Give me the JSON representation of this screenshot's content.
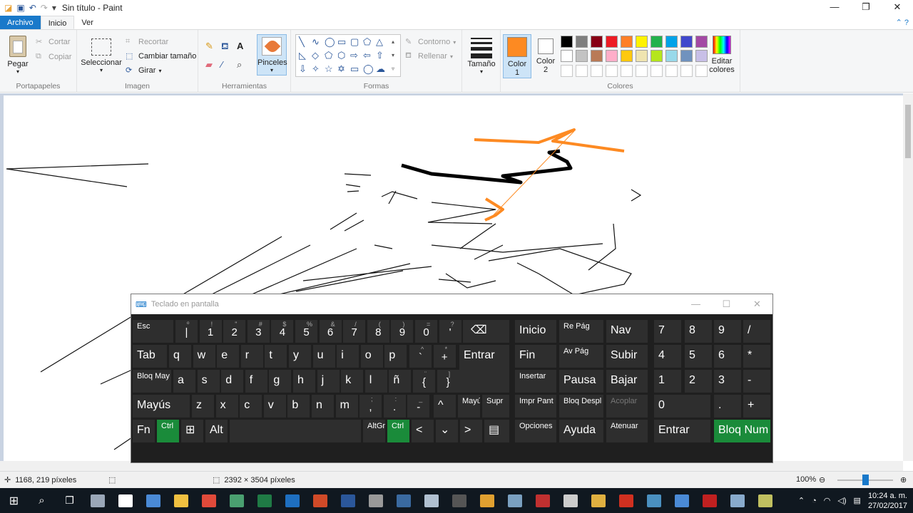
{
  "window": {
    "title": "Sin título - Paint",
    "controls": {
      "minimize": "—",
      "maximize": "❐",
      "close": "✕"
    }
  },
  "tabs": {
    "file": "Archivo",
    "home": "Inicio",
    "view": "Ver"
  },
  "ribbon": {
    "clipboard": {
      "paste": "Pegar",
      "cut": "Cortar",
      "copy": "Copiar",
      "label": "Portapapeles"
    },
    "image": {
      "select": "Seleccionar",
      "crop": "Recortar",
      "resize": "Cambiar tamaño",
      "rotate": "Girar",
      "label": "Imagen"
    },
    "tools": {
      "label": "Herramientas",
      "brushes": "Pinceles"
    },
    "shapes": {
      "outline": "Contorno",
      "fill": "Rellenar",
      "label": "Formas"
    },
    "size": {
      "label": "Tamaño"
    },
    "color1": {
      "line1": "Color",
      "line2": "1",
      "value": "#fd8a22"
    },
    "color2": {
      "line1": "Color",
      "line2": "2",
      "value": "#ffffff"
    },
    "colors": {
      "label": "Colores",
      "edit_line1": "Editar",
      "edit_line2": "colores",
      "row1": [
        "#000000",
        "#7f7f7f",
        "#880015",
        "#ed1c24",
        "#ff7f27",
        "#fff200",
        "#22b14c",
        "#00a2e8",
        "#3f48cc",
        "#a349a4"
      ],
      "row2": [
        "#ffffff",
        "#c3c3c3",
        "#b97a57",
        "#ffaec9",
        "#ffc90e",
        "#efe4b0",
        "#b5e61d",
        "#99d9ea",
        "#7092be",
        "#c8bfe7"
      ]
    }
  },
  "status": {
    "cursor_pos": "1168, 219 píxeles",
    "canvas_size": "2392 × 3504 píxeles",
    "zoom": "100%",
    "zoom_level": 0.5
  },
  "osk": {
    "title": "Teclado en pantalla",
    "row1": [
      {
        "sup": "",
        "main": "Esc"
      },
      {
        "sup": "º",
        "main": "|"
      },
      {
        "sup": "!",
        "main": "1"
      },
      {
        "sup": "\"",
        "main": "2"
      },
      {
        "sup": "#",
        "main": "3"
      },
      {
        "sup": "$",
        "main": "4"
      },
      {
        "sup": "%",
        "main": "5"
      },
      {
        "sup": "&",
        "main": "6"
      },
      {
        "sup": "/",
        "main": "7"
      },
      {
        "sup": "(",
        "main": "8"
      },
      {
        "sup": ")",
        "main": "9"
      },
      {
        "sup": "=",
        "main": "0"
      },
      {
        "sup": "?",
        "main": "'"
      },
      {
        "sup": "¡",
        "main": "¿"
      }
    ],
    "backspace": "⌫",
    "row2": [
      "Tab",
      "q",
      "w",
      "e",
      "r",
      "t",
      "y",
      "u",
      "i",
      "o",
      "p"
    ],
    "row2_extra": [
      {
        "sup": "^",
        "main": "`"
      },
      {
        "sup": "*",
        "main": "+"
      }
    ],
    "enter": "Entrar",
    "row3_first": "Bloq May",
    "row3": [
      "a",
      "s",
      "d",
      "f",
      "g",
      "h",
      "j",
      "k",
      "l",
      "ñ"
    ],
    "row3_extra": [
      {
        "sup": "¨",
        "main": "{"
      },
      {
        "sup": "]",
        "main": "}"
      }
    ],
    "row4_first": "Mayús",
    "row4": [
      "z",
      "x",
      "c",
      "v",
      "b",
      "n",
      "m"
    ],
    "row4_extra": [
      {
        "sup": ";",
        "main": ","
      },
      {
        "sup": ":",
        "main": "."
      },
      {
        "sup": "_",
        "main": "-"
      }
    ],
    "arrow_up": "^",
    "row4_mayus_small": "Mayús",
    "supr": "Supr",
    "row5": {
      "fn": "Fn",
      "ctrl": "Ctrl",
      "win": "⊞",
      "alt": "Alt",
      "altgr": "AltGr",
      "ctrl2": "Ctrl",
      "left": "<",
      "down": "⌄",
      "right": ">",
      "menu": "▤"
    },
    "nav": {
      "inicio": "Inicio",
      "repag": "Re Pág",
      "nav": "Nav",
      "fin": "Fin",
      "avpag": "Av Pág",
      "subir": "Subir",
      "insertar": "Insertar",
      "pausa": "Pausa",
      "bajar": "Bajar",
      "imprpant": "Impr Pant",
      "bloqdespl": "Bloq Despl",
      "acoplar": "Acoplar",
      "opciones": "Opciones",
      "ayuda": "Ayuda",
      "atenuar": "Atenuar"
    },
    "numpad": {
      "r1": [
        "7",
        "8",
        "9",
        "/"
      ],
      "r2": [
        "4",
        "5",
        "6",
        "*"
      ],
      "r3": [
        "1",
        "2",
        "3",
        "-"
      ],
      "zero": "0",
      "dot": ".",
      "plus": "+",
      "enter": "Entrar",
      "bloqnum": "Bloq Num"
    }
  },
  "taskbar": {
    "time": "10:24 a. m.",
    "date": "27/02/2017"
  }
}
